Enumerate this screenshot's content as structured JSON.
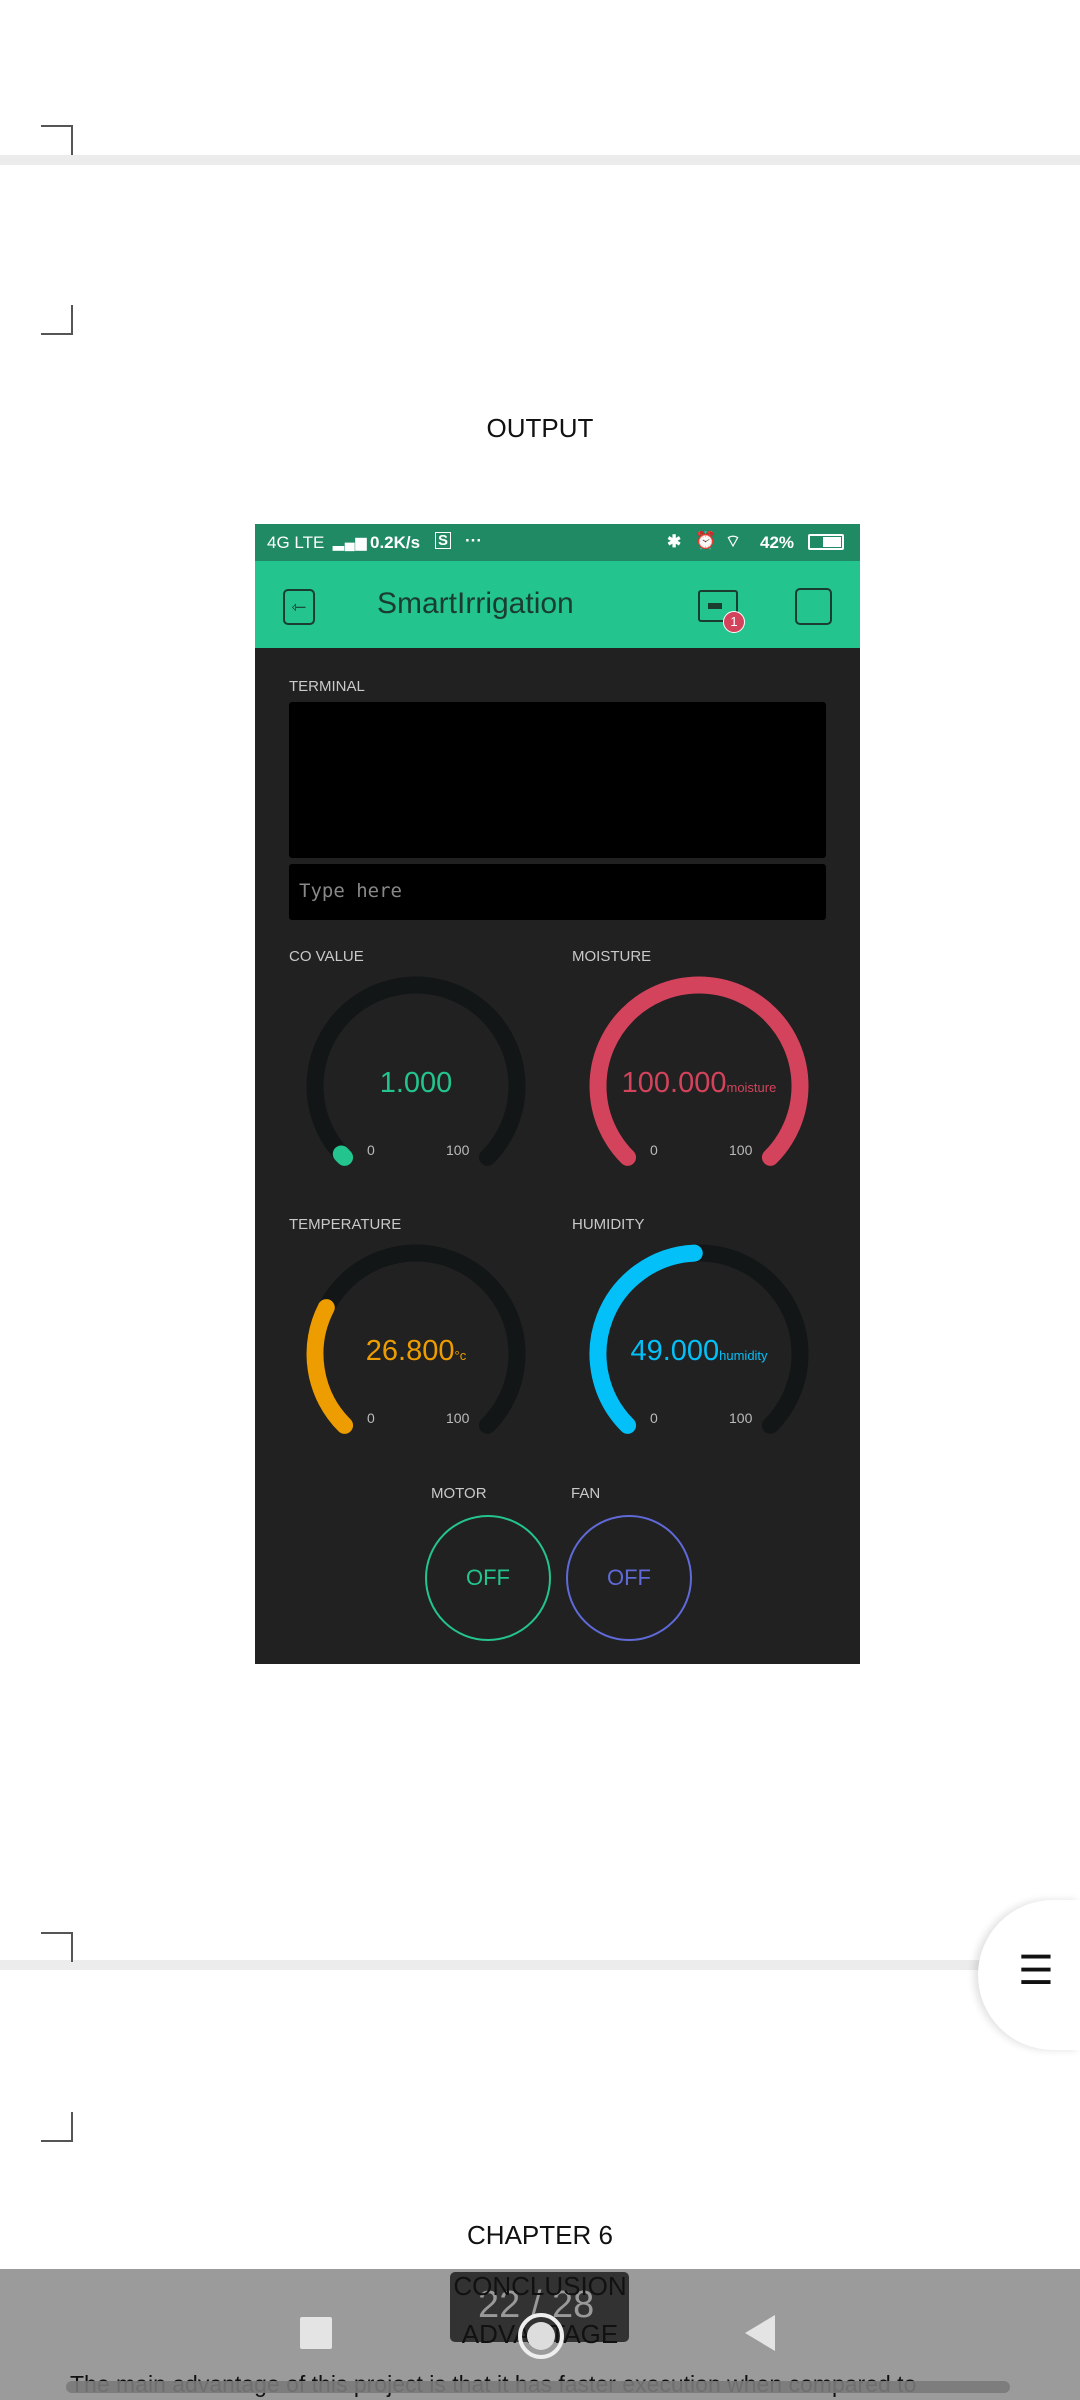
{
  "document": {
    "output_heading": "OUTPUT",
    "chapter_heading": "CHAPTER 6",
    "conclusion_heading": "CONCLUSION",
    "advantage_heading": "ADVANTAGE",
    "body_line": "The main advantage of this project is that it has faster execution when compared to",
    "page_indicator": "22 / 28"
  },
  "phone": {
    "status": {
      "network": "4G LTE",
      "speed": "0.2K/s",
      "more": "···",
      "battery": "42%"
    },
    "app": {
      "title": "SmartIrrigation",
      "notification_count": "1"
    },
    "terminal": {
      "label": "TERMINAL",
      "placeholder": "Type here"
    },
    "gauges": [
      {
        "label": "CO VALUE",
        "value": "1.000",
        "unit": "",
        "fraction": 0.01,
        "min": "0",
        "max": "100",
        "color": "#23c48e"
      },
      {
        "label": "MOISTURE",
        "value": "100.000",
        "unit": "moisture",
        "fraction": 1.0,
        "min": "0",
        "max": "100",
        "color": "#d3435c"
      },
      {
        "label": "TEMPERATURE",
        "value": "26.800",
        "unit": "°c",
        "fraction": 0.268,
        "min": "0",
        "max": "100",
        "color": "#ed9d00"
      },
      {
        "label": "HUMIDITY",
        "value": "49.000",
        "unit": "humidity",
        "fraction": 0.49,
        "min": "0",
        "max": "100",
        "color": "#04c0f8"
      }
    ],
    "buttons": [
      {
        "label": "MOTOR",
        "state": "OFF",
        "color": "#23c48e"
      },
      {
        "label": "FAN",
        "state": "OFF",
        "color": "#5f6ad8"
      }
    ]
  }
}
